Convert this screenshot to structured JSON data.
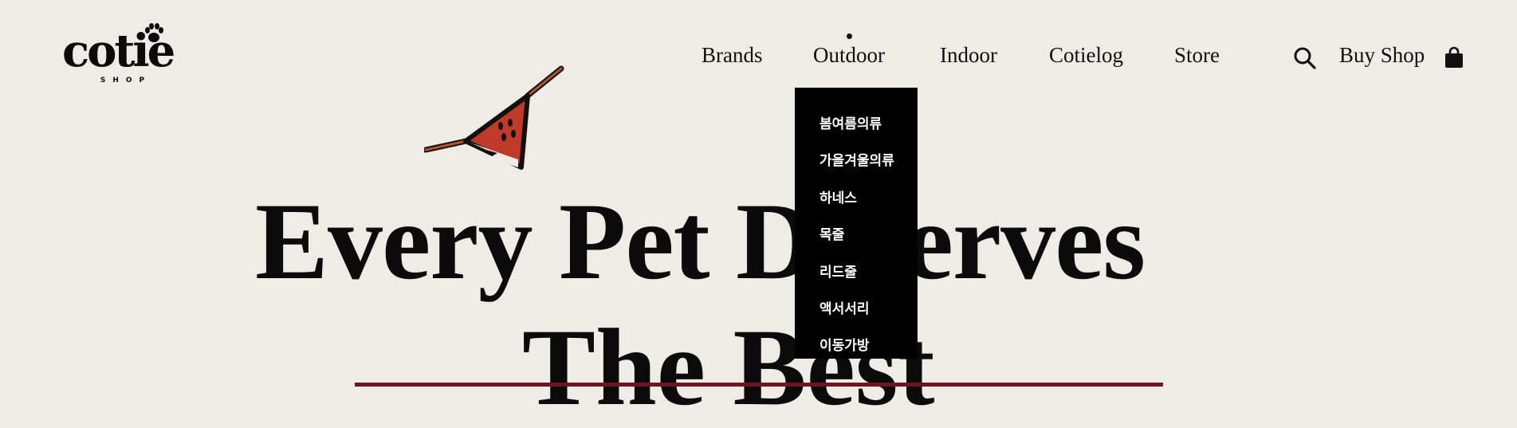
{
  "header": {
    "logo": {
      "text": "cotie",
      "subtext": "SHOP"
    },
    "nav": [
      {
        "label": "Brands",
        "active": false
      },
      {
        "label": "Outdoor",
        "active": true
      },
      {
        "label": "Indoor",
        "active": false
      },
      {
        "label": "Cotielog",
        "active": false
      },
      {
        "label": "Store",
        "active": false
      }
    ],
    "icons": {
      "search": "search-icon",
      "bag": "shopping-bag-icon"
    },
    "buy_shop_label": "Buy Shop"
  },
  "dropdown": {
    "items": [
      "봄여름의류",
      "가을겨울의류",
      "하네스",
      "목줄",
      "리드줄",
      "액서서리",
      "이동가방"
    ]
  },
  "hero": {
    "line1": "Every Pet Deserves",
    "line2": "The Best"
  },
  "colors": {
    "background": "#efece6",
    "text": "#111111",
    "dropdown_bg": "#000000",
    "accent_bar": "#6c1620",
    "pennant_red": "#c0392b"
  }
}
